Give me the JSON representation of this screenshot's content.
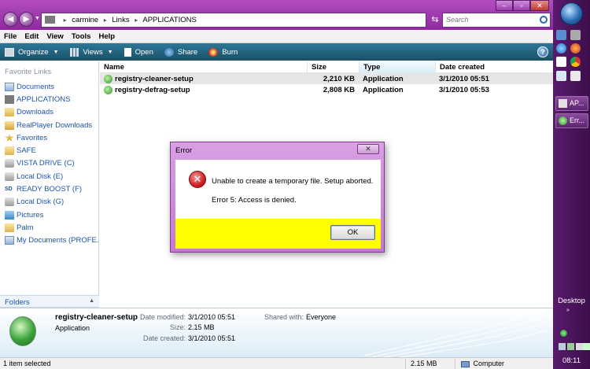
{
  "address": {
    "segments": [
      "carmine",
      "Links",
      "APPLICATIONS"
    ],
    "separator": "▸"
  },
  "search": {
    "placeholder": "Search"
  },
  "menu": [
    "File",
    "Edit",
    "View",
    "Tools",
    "Help"
  ],
  "toolbar": {
    "organize": "Organize",
    "views": "Views",
    "open": "Open",
    "share": "Share",
    "burn": "Burn"
  },
  "nav": {
    "title": "Favorite Links",
    "items": [
      {
        "label": "Documents",
        "icon": "documents-icon"
      },
      {
        "label": "APPLICATIONS",
        "icon": "applications-folder-icon"
      },
      {
        "label": "Downloads",
        "icon": "downloads-folder-icon"
      },
      {
        "label": "RealPlayer Downloads",
        "icon": "realplayer-folder-icon"
      },
      {
        "label": "Favorites",
        "icon": "favorites-star-icon"
      },
      {
        "label": "SAFE",
        "icon": "safe-folder-icon"
      },
      {
        "label": "VISTA DRIVE (C)",
        "icon": "drive-icon"
      },
      {
        "label": "Local Disk (E)",
        "icon": "drive-icon"
      },
      {
        "label": "READY BOOST (F)",
        "icon": "sd-card-icon"
      },
      {
        "label": "Local Disk (G)",
        "icon": "drive-icon"
      },
      {
        "label": "Pictures",
        "icon": "pictures-icon"
      },
      {
        "label": "Palm",
        "icon": "palm-folder-icon"
      },
      {
        "label": "My Documents (PROFE...",
        "icon": "documents-icon"
      }
    ],
    "folders_label": "Folders"
  },
  "files": {
    "columns": [
      "Name",
      "Size",
      "Type",
      "Date created"
    ],
    "rows": [
      {
        "name": "registry-cleaner-setup",
        "size": "2,210 KB",
        "type": "Application",
        "date": "3/1/2010 05:51"
      },
      {
        "name": "registry-defrag-setup",
        "size": "2,808 KB",
        "type": "Application",
        "date": "3/1/2010 05:53"
      }
    ]
  },
  "details": {
    "name": "registry-cleaner-setup",
    "type": "Application",
    "date_modified_label": "Date modified:",
    "date_modified": "3/1/2010 05:51",
    "size_label": "Size:",
    "size": "2.15 MB",
    "date_created_label": "Date created:",
    "date_created": "3/1/2010 05:51",
    "shared_label": "Shared with:",
    "shared": "Everyone"
  },
  "status": {
    "selected": "1 item selected",
    "size": "2.15 MB",
    "location": "Computer"
  },
  "dialog": {
    "title": "Error",
    "close": "✕",
    "message": "Unable to create a temporary file. Setup aborted.",
    "error": "Error 5: Access is denied.",
    "ok": "OK"
  },
  "taskbar": {
    "tasks": [
      {
        "label": "AP..."
      },
      {
        "label": "Err..."
      }
    ],
    "desktop_label": "Desktop",
    "clock": "08:11"
  },
  "colors": {
    "title_bar": "#9c3cae",
    "toolbar": "#1f5f7c",
    "dialog_footer": "#ffff00",
    "taskbar": "#4a1459"
  }
}
